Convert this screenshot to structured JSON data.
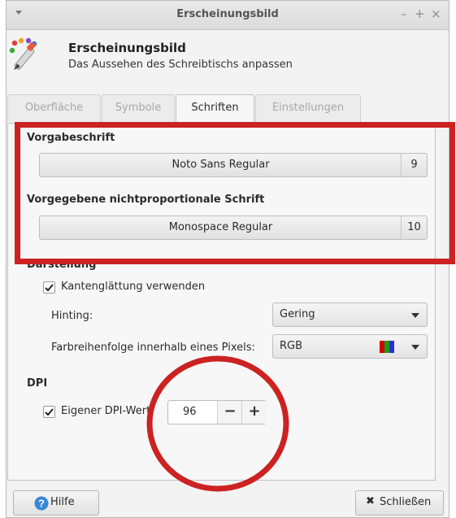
{
  "window": {
    "title": "Erscheinungsbild",
    "buttons": {
      "minimize": "–",
      "maximize": "+",
      "close": "×"
    }
  },
  "header": {
    "title": "Erscheinungsbild",
    "subtitle": "Das Aussehen des Schreibtischs anpassen",
    "icon": "paint-brush-palette-icon"
  },
  "tabs": [
    {
      "label": "Oberfläche",
      "active": false
    },
    {
      "label": "Symbole",
      "active": false
    },
    {
      "label": "Schriften",
      "active": true
    },
    {
      "label": "Einstellungen",
      "active": false
    }
  ],
  "fonts": {
    "default": {
      "heading": "Vorgabeschrift",
      "name": "Noto Sans Regular",
      "size": "9"
    },
    "monospace": {
      "heading": "Vorgegebene nichtproportionale Schrift",
      "name": "Monospace Regular",
      "size": "10"
    }
  },
  "rendering": {
    "heading": "Darstellung",
    "antialias": {
      "label": "Kantenglättung verwenden",
      "checked": true
    },
    "hinting": {
      "label": "Hinting:",
      "value": "Gering"
    },
    "subpixel": {
      "label": "Farbreihenfolge innerhalb eines Pixels:",
      "value": "RGB",
      "swatch_colors": [
        "#d40000",
        "#1a9a1a",
        "#2f2fd0"
      ]
    }
  },
  "dpi": {
    "heading": "DPI",
    "custom": {
      "label": "Eigener DPI-Wert:",
      "checked": true
    },
    "value": "96",
    "decrement": "−",
    "increment": "+"
  },
  "footer": {
    "help": {
      "label": "Hilfe",
      "icon": "help-icon"
    },
    "close": {
      "label": "Schließen",
      "icon": "close-x-icon"
    }
  },
  "colors": {
    "annotation_red": "#cc2222",
    "help_blue": "#3a86d8"
  }
}
